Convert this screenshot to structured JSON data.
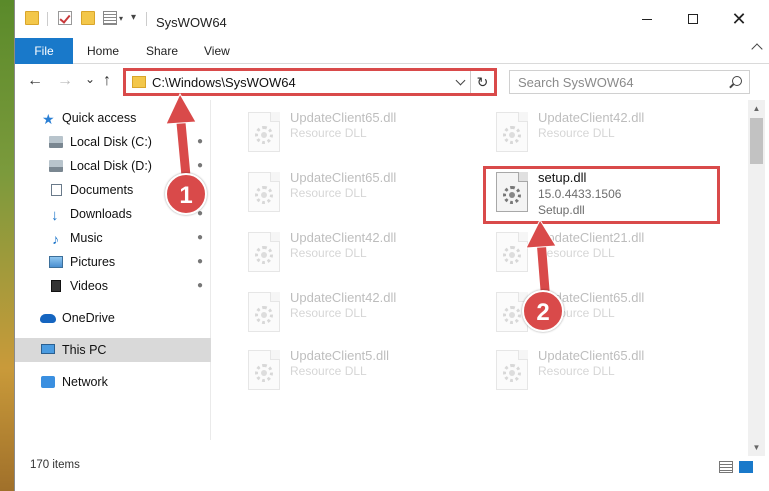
{
  "window": {
    "title": "SysWOW64"
  },
  "ribbon": {
    "tabs": [
      {
        "label": "File"
      },
      {
        "label": "Home"
      },
      {
        "label": "Share"
      },
      {
        "label": "View"
      }
    ]
  },
  "address": {
    "path": "C:\\Windows\\SysWOW64",
    "search_placeholder": "Search SysWOW64"
  },
  "sidebar": {
    "items": [
      {
        "label": "Quick access",
        "icon": "star-icon",
        "pinned": false
      },
      {
        "label": "Local Disk (C:)",
        "icon": "disk-icon",
        "pinned": true
      },
      {
        "label": "Local Disk (D:)",
        "icon": "disk-icon",
        "pinned": true
      },
      {
        "label": "Documents",
        "icon": "documents-icon",
        "pinned": true
      },
      {
        "label": "Downloads",
        "icon": "downloads-icon",
        "pinned": true
      },
      {
        "label": "Music",
        "icon": "music-icon",
        "pinned": true
      },
      {
        "label": "Pictures",
        "icon": "pictures-icon",
        "pinned": true
      },
      {
        "label": "Videos",
        "icon": "videos-icon",
        "pinned": true
      },
      {
        "label": "OneDrive",
        "icon": "onedrive-icon",
        "pinned": false
      },
      {
        "label": "This PC",
        "icon": "pc-icon",
        "pinned": false,
        "selected": true
      },
      {
        "label": "Network",
        "icon": "network-icon",
        "pinned": false
      }
    ]
  },
  "files": [
    {
      "name": "UpdateClient65.dll",
      "sub": "Resource DLL",
      "faded": true
    },
    {
      "name": "UpdateClient42.dll",
      "sub": "Resource DLL",
      "faded": true
    },
    {
      "name": "UpdateClient65.dll",
      "sub": "Resource DLL",
      "faded": true
    },
    {
      "name": "setup.dll",
      "version": "15.0.4433.1506",
      "sub": "Setup.dll",
      "faded": false,
      "highlighted": true
    },
    {
      "name": "UpdateClient42.dll",
      "sub": "Resource DLL",
      "faded": true
    },
    {
      "name": "UpdateClient21.dll",
      "sub": "Resource DLL",
      "faded": true
    },
    {
      "name": "UpdateClient42.dll",
      "sub": "Resource DLL",
      "faded": true
    },
    {
      "name": "UpdateClient65.dll",
      "sub": "Resource DLL",
      "faded": true
    },
    {
      "name": "UpdateClient5.dll",
      "sub": "Resource DLL",
      "faded": true
    },
    {
      "name": "UpdateClient65.dll",
      "sub": "Resource DLL",
      "faded": true
    }
  ],
  "status": {
    "item_count": "170 items"
  },
  "callouts": [
    {
      "label": "1"
    },
    {
      "label": "2"
    }
  ],
  "colors": {
    "accent": "#1979ca",
    "callout_red": "#d94a4a",
    "selected_bg": "#d9d9d9"
  },
  "icons": {
    "nav_back": "←",
    "nav_forward": "→",
    "nav_recent": "⌄",
    "nav_up": "↑",
    "refresh": "↻",
    "close": "✕",
    "pin": "📌",
    "star": "★",
    "download": "↓",
    "music": "♪",
    "scroll_up": "▲",
    "scroll_down": "▼"
  }
}
